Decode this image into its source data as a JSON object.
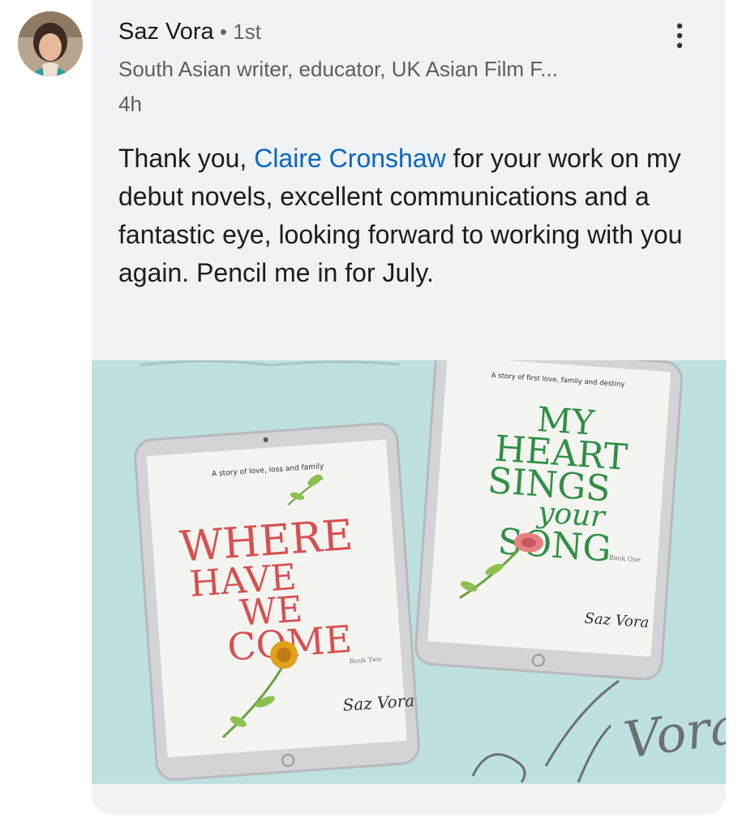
{
  "author": {
    "name": "Saz Vora",
    "separator": " • ",
    "degree": "1st",
    "headline": "South Asian writer, educator, UK Asian Film F...",
    "time": "4h"
  },
  "post": {
    "text_before": "Thank you, ",
    "mention": "Claire Cronshaw",
    "text_after": " for your work on my debut novels, excellent communications and a fantastic eye, looking forward to working with you again.  Pencil me in for July."
  },
  "media": {
    "book_left": {
      "tagline": "A story of love, loss and family",
      "title_lines": [
        "WHERE",
        "HAVE",
        "WE",
        "COME"
      ],
      "book_number": "Book Two",
      "author_sig": "Saz Vora"
    },
    "book_right": {
      "tagline": "A story of first love, family and destiny",
      "title_lines": [
        "MY",
        "HEART",
        "SINGS",
        "your",
        "SONG"
      ],
      "book_number": "Book One",
      "author_sig": "Saz Vora"
    },
    "signature": "Vora",
    "colors": {
      "left_title": "#d84f4f",
      "right_title": "#2f8f45",
      "background": "#bee0e1"
    }
  },
  "icons": {
    "menu": "more-vertical-icon"
  }
}
